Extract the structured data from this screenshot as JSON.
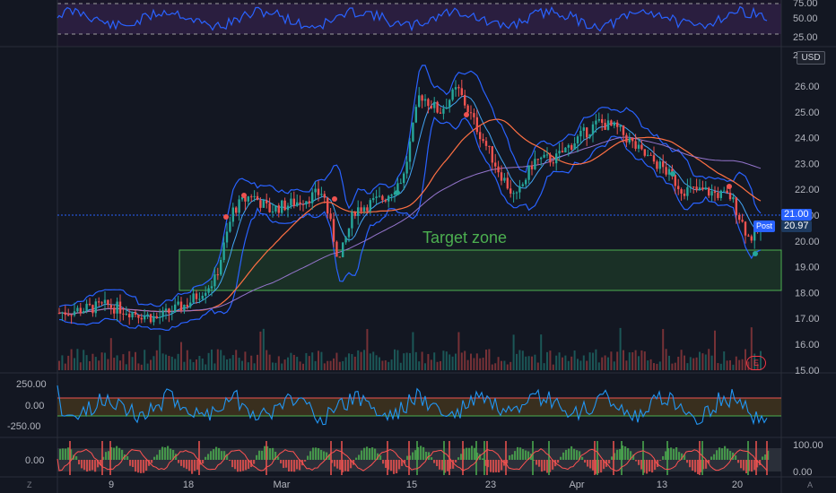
{
  "price_axis": {
    "unit_label": "USD",
    "ticks": [
      "26.00",
      "25.00",
      "24.00",
      "23.00",
      "22.00",
      "21.00",
      "20.00",
      "19.00",
      "18.00",
      "17.00",
      "16.00",
      "15.00"
    ],
    "top_partial": "2",
    "last_price": "21.00",
    "post_label": "Post",
    "post_price": "20.97"
  },
  "rsi_axis": {
    "ticks": [
      "75.00",
      "50.00",
      "25.00"
    ]
  },
  "cci_axis": {
    "ticks": [
      "250.00",
      "0.00",
      "-250.00"
    ]
  },
  "stoch_axis": {
    "left_value": "0.00",
    "ticks": [
      "100.00",
      "0.00"
    ]
  },
  "time_axis": {
    "labels": [
      "9",
      "18",
      "Mar",
      "15",
      "23",
      "Apr",
      "13",
      "20"
    ]
  },
  "annotations": {
    "zone_label": "Target zone",
    "earnings_marker": "E"
  },
  "corners": {
    "left": "Z",
    "right": "A"
  },
  "colors": {
    "background": "#131722",
    "up": "#26a69a",
    "down": "#ef5350",
    "bb_band": "#2962ff",
    "bb_mid": "#42a5f5",
    "ma_orange": "#ff7043",
    "ma_purple": "#9575cd",
    "zone": "#4caf50",
    "price_tag": "#2962ff"
  },
  "icons": [
    "earnings-icon"
  ]
}
